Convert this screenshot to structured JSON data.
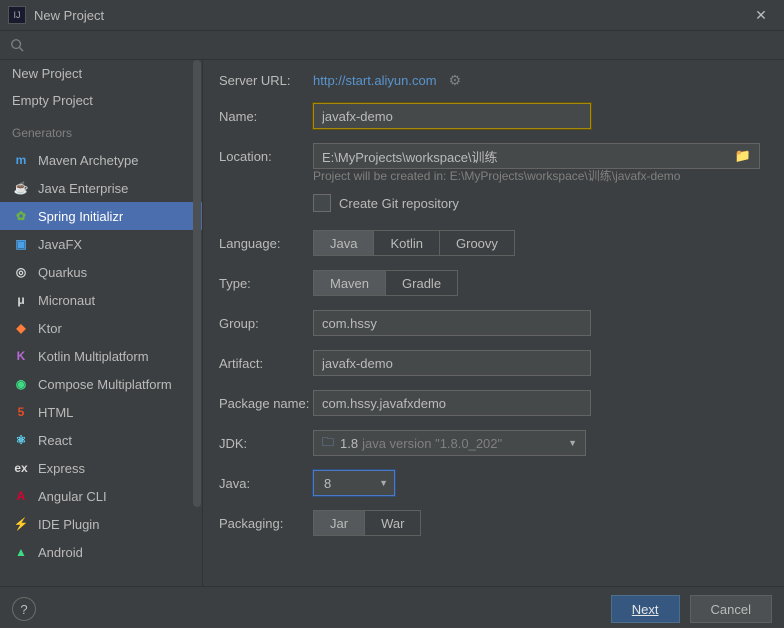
{
  "window": {
    "title": "New Project"
  },
  "sidebar": {
    "section1": [
      {
        "label": "New Project"
      },
      {
        "label": "Empty Project"
      }
    ],
    "generators_label": "Generators",
    "generators": [
      {
        "label": "Maven Archetype",
        "icon": "m",
        "color": "#4aa0e6"
      },
      {
        "label": "Java Enterprise",
        "icon": "cup",
        "color": "#f0a732"
      },
      {
        "label": "Spring Initializr",
        "icon": "leaf",
        "color": "#6db33f",
        "selected": true
      },
      {
        "label": "JavaFX",
        "icon": "fx",
        "color": "#4aa0e6"
      },
      {
        "label": "Quarkus",
        "icon": "q",
        "color": "#d8d8d8"
      },
      {
        "label": "Micronaut",
        "icon": "μ",
        "color": "#d8d8d8"
      },
      {
        "label": "Ktor",
        "icon": "kt",
        "color": "#ff7d3b"
      },
      {
        "label": "Kotlin Multiplatform",
        "icon": "K",
        "color": "#b669d6"
      },
      {
        "label": "Compose Multiplatform",
        "icon": "cmp",
        "color": "#3ddc84"
      },
      {
        "label": "HTML",
        "icon": "5",
        "color": "#e44d26"
      },
      {
        "label": "React",
        "icon": "react",
        "color": "#61dafb"
      },
      {
        "label": "Express",
        "icon": "ex",
        "color": "#d8d8d8"
      },
      {
        "label": "Angular CLI",
        "icon": "A",
        "color": "#dd0031"
      },
      {
        "label": "IDE Plugin",
        "icon": "plug",
        "color": "#d8d8d8"
      },
      {
        "label": "Android",
        "icon": "and",
        "color": "#3ddc84"
      }
    ]
  },
  "form": {
    "server_url_label": "Server URL:",
    "server_url": "http://start.aliyun.com",
    "name_label": "Name:",
    "name": "javafx-demo",
    "location_label": "Location:",
    "location": "E:\\MyProjects\\workspace\\训练",
    "location_hint": "Project will be created in: E:\\MyProjects\\workspace\\训练\\javafx-demo",
    "create_git_label": "Create Git repository",
    "language_label": "Language:",
    "language_options": [
      "Java",
      "Kotlin",
      "Groovy"
    ],
    "language_selected": "Java",
    "type_label": "Type:",
    "type_options": [
      "Maven",
      "Gradle"
    ],
    "type_selected": "Maven",
    "group_label": "Group:",
    "group": "com.hssy",
    "artifact_label": "Artifact:",
    "artifact": "javafx-demo",
    "package_label": "Package name:",
    "package": "com.hssy.javafxdemo",
    "jdk_label": "JDK:",
    "jdk_version": "1.8",
    "jdk_detail": "java version \"1.8.0_202\"",
    "java_label": "Java:",
    "java": "8",
    "packaging_label": "Packaging:",
    "packaging_options": [
      "Jar",
      "War"
    ],
    "packaging_selected": "Jar"
  },
  "footer": {
    "next": "Next",
    "cancel": "Cancel"
  }
}
